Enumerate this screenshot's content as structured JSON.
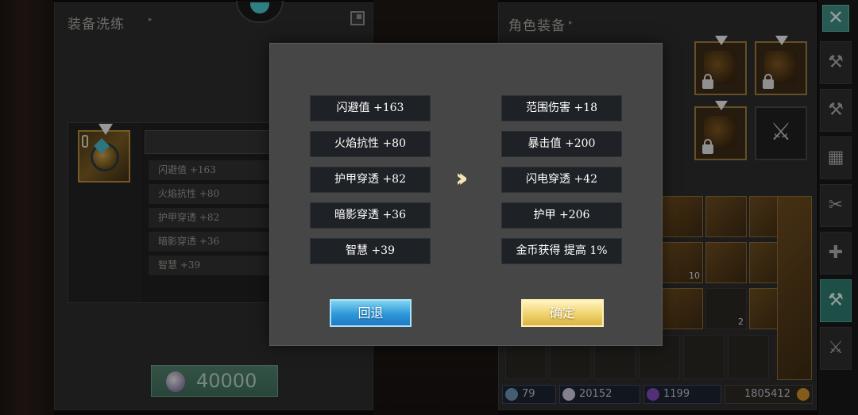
{
  "left_panel": {
    "title": "装备洗练",
    "current_stats": [
      "闪避值 +163",
      "火焰抗性 +80",
      "护甲穿透 +82",
      "暗影穿透 +36",
      "智慧 +39"
    ],
    "cost": "40000"
  },
  "right_panel": {
    "title": "角色装备",
    "inventory_counts": [
      "10",
      "2"
    ],
    "currencies": [
      "79",
      "20152",
      "1199",
      "1805412"
    ]
  },
  "modal": {
    "old_stats": [
      "闪避值 +163",
      "火焰抗性 +80",
      "护甲穿透 +82",
      "暗影穿透 +36",
      "智慧 +39"
    ],
    "new_stats": [
      "范围伤害 +18",
      "暴击值 +200",
      "闪电穿透 +42",
      "护甲 +206",
      "金币获得 提高 1%"
    ],
    "back_label": "回退",
    "confirm_label": "确定"
  },
  "toolbar": {
    "close_symbol": "✕"
  },
  "colors": {
    "accent_teal": "#3e8a82",
    "back_button": "#2f97d9",
    "confirm_button": "#f0d36c",
    "gold_frame": "#9b7a3c"
  }
}
